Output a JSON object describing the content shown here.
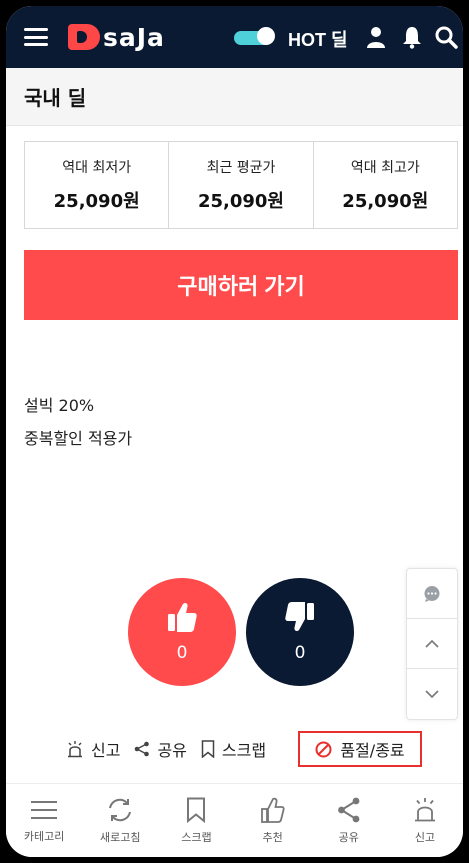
{
  "header": {
    "logo_text": "saJa",
    "hot_label": "HOT 딜",
    "icons": [
      "menu-icon",
      "user-icon",
      "bell-icon",
      "search-icon"
    ],
    "colors": {
      "bar": "#0b1a33",
      "brand": "#ff4747",
      "toggle": "#4fd1d9"
    }
  },
  "page": {
    "title": "국내 딜"
  },
  "prices": [
    {
      "label": "역대 최저가",
      "value": "25,090원"
    },
    {
      "label": "최근 평균가",
      "value": "25,090원"
    },
    {
      "label": "역대 최고가",
      "value": "25,090원"
    }
  ],
  "buy_button": "구매하러 가기",
  "description": [
    "설빅 20%",
    "중복할인 적용가"
  ],
  "votes": {
    "up": "0",
    "down": "0"
  },
  "side_panel": [
    "chat-icon",
    "chevron-up-icon",
    "chevron-down-icon"
  ],
  "actions": {
    "report": "신고",
    "share": "공유",
    "scrap": "스크랩",
    "soldout": "품절/종료"
  },
  "bottom_nav": [
    {
      "label": "카테고리",
      "icon": "menu-icon"
    },
    {
      "label": "새로고침",
      "icon": "refresh-icon"
    },
    {
      "label": "스크랩",
      "icon": "bookmark-icon"
    },
    {
      "label": "추천",
      "icon": "thumbs-up-icon"
    },
    {
      "label": "공유",
      "icon": "share-icon"
    },
    {
      "label": "신고",
      "icon": "siren-icon"
    }
  ]
}
